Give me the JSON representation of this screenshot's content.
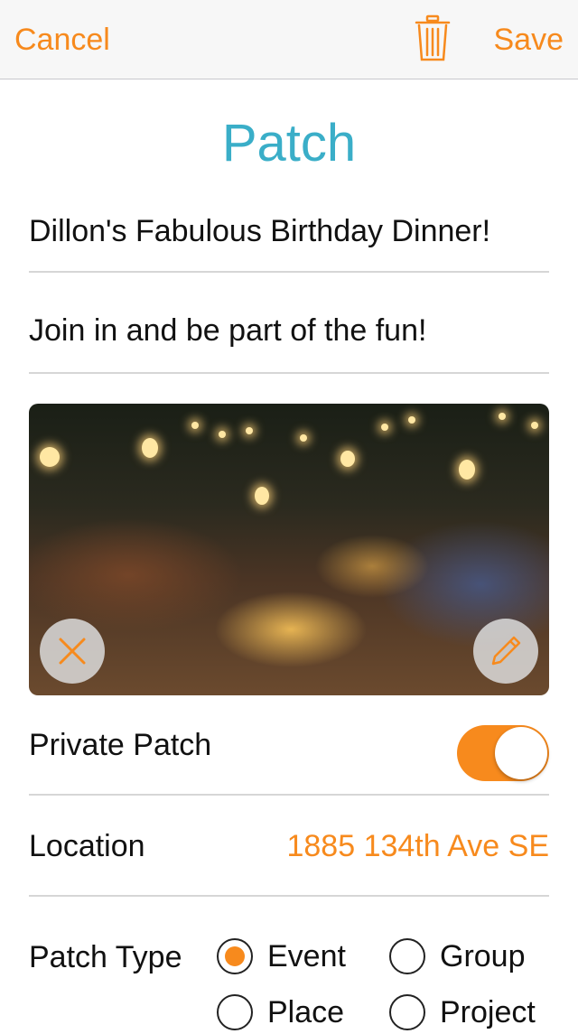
{
  "nav": {
    "cancel_label": "Cancel",
    "save_label": "Save"
  },
  "page_title": "Patch",
  "form": {
    "title_value": "Dillon's Fabulous Birthday Dinner!",
    "description_value": "Join in and be part of the fun!"
  },
  "private_patch": {
    "label": "Private Patch",
    "enabled": true
  },
  "location": {
    "label": "Location",
    "value": "1885 134th Ave SE"
  },
  "patch_type": {
    "label": "Patch Type",
    "options": [
      "Event",
      "Group",
      "Place",
      "Project"
    ],
    "selected": "Event"
  },
  "colors": {
    "accent": "#f78a1d",
    "title": "#3aaec8"
  },
  "icons": {
    "trash": "trash-icon",
    "remove_photo": "close-icon",
    "edit_photo": "pencil-icon"
  }
}
